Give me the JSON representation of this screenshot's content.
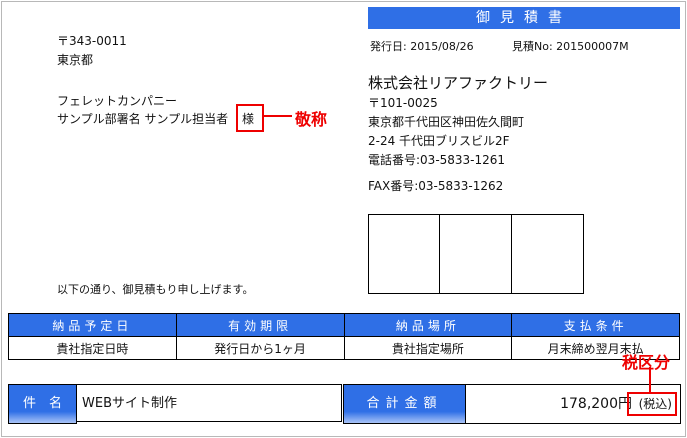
{
  "title": "御見積書",
  "issue": {
    "date_label": "発行日:",
    "date": "2015/08/26",
    "no_label": "見積No:",
    "no": "201500007M"
  },
  "recipient": {
    "postal": "〒343-0011",
    "prefecture": "東京都",
    "company": "フェレットカンパニー",
    "dept_person": "サンプル部署名 サンプル担当者",
    "honorific": "様"
  },
  "issuer": {
    "company": "株式会社リアファクトリー",
    "postal": "〒101-0025",
    "address1": "東京都千代田区神田佐久間町",
    "address2": "2-24 千代田ブリスビル2F",
    "tel": "電話番号:03-5833-1261",
    "fax": "FAX番号:03-5833-1262"
  },
  "message": "以下の通り、御見積もり申し上げます。",
  "conditions": {
    "headers": [
      "納品予定日",
      "有効期限",
      "納品場所",
      "支払条件"
    ],
    "values": [
      "貴社指定日時",
      "発行日から1ヶ月",
      "貴社指定場所",
      "月末締め翌月末払"
    ]
  },
  "subject": {
    "label": "件　名",
    "value": "WEBサイト制作"
  },
  "total": {
    "label": "合計金額",
    "amount": "178,200",
    "unit": "円",
    "tax": "(税込)"
  },
  "annotations": {
    "honorific": "敬称",
    "tax": "税区分"
  },
  "colors": {
    "accent": "#2f6fe6",
    "annotation": "#e00000"
  }
}
